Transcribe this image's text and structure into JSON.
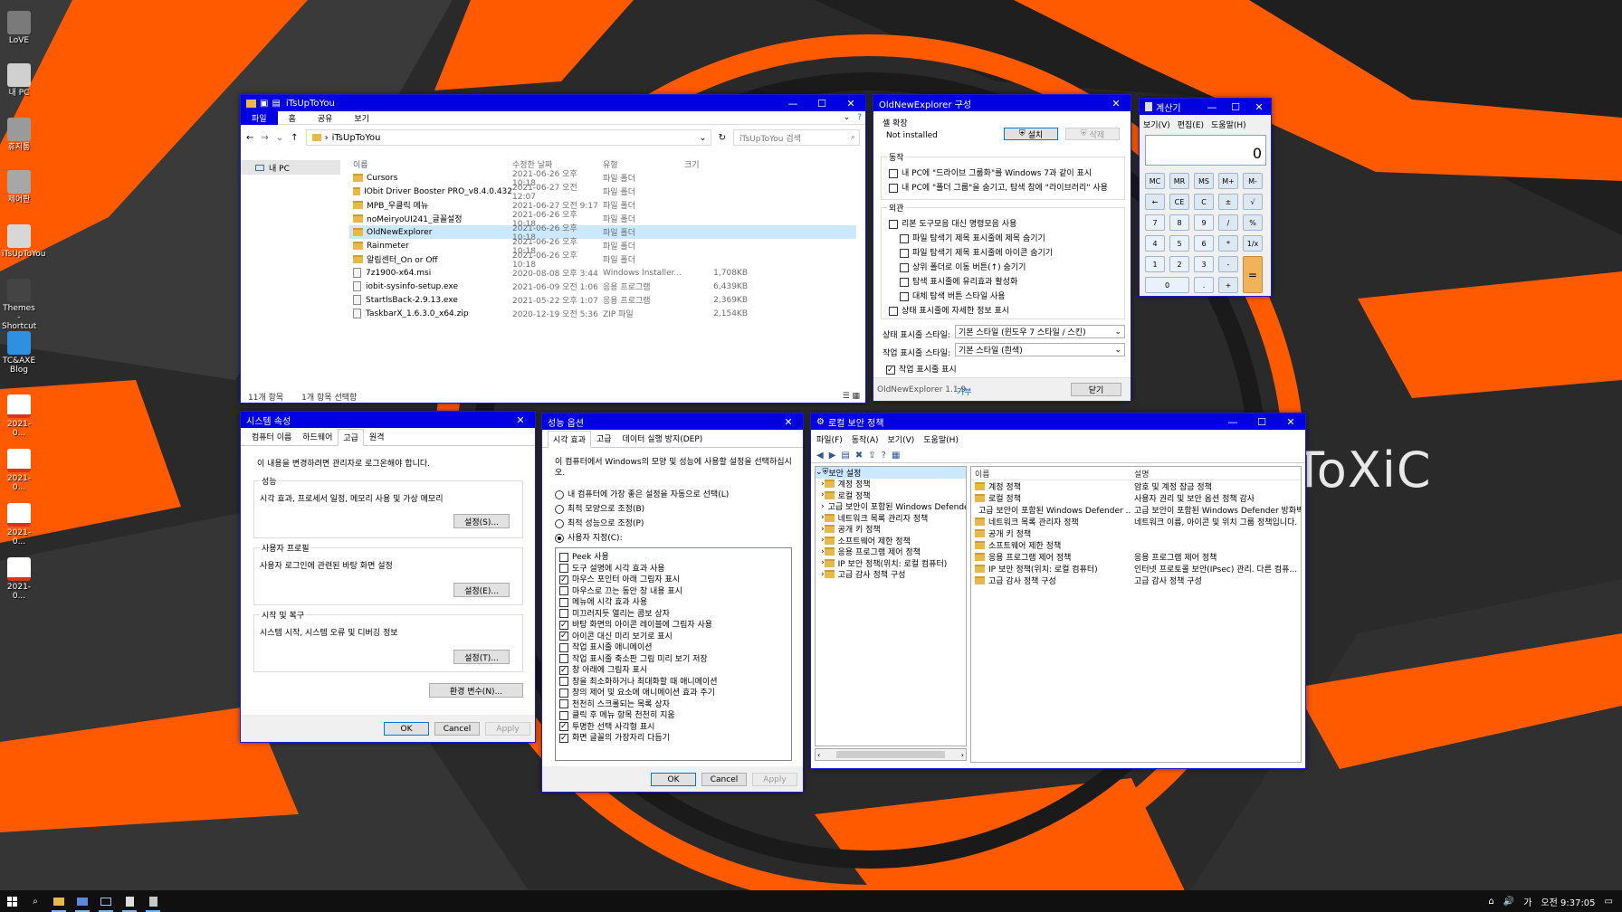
{
  "wallpaper": {
    "brand": "ToXiC",
    "colors": {
      "orange": "#ff5a00",
      "dark": "#262626",
      "mid": "#4a4a4a"
    }
  },
  "desktop_icons": [
    {
      "label": "LoVE",
      "icon": "user-icon"
    },
    {
      "label": "내 PC",
      "icon": "computer-icon"
    },
    {
      "label": "휴지통",
      "icon": "recycle-bin-icon"
    },
    {
      "label": "제어판",
      "icon": "control-panel-icon"
    },
    {
      "label": "iTsUpToYou",
      "icon": "document-icon"
    },
    {
      "label": "Themes - Shortcut",
      "icon": "shortcut-icon"
    },
    {
      "label": "TC&AXE Blog",
      "icon": "cloud-icon"
    },
    {
      "label": "2021-0...",
      "icon": "file-icon"
    },
    {
      "label": "2021-0...",
      "icon": "file-icon"
    },
    {
      "label": "2021-0...",
      "icon": "file-icon"
    },
    {
      "label": "2021-0...",
      "icon": "file-icon"
    }
  ],
  "explorer": {
    "title": "iTsUpToYou",
    "ribbon": [
      "파일",
      "홈",
      "공유",
      "보기"
    ],
    "address": "iTsUpToYou",
    "search_placeholder": "iTsUpToYou 검색",
    "nav": [
      "내 PC"
    ],
    "columns": {
      "name": "이름",
      "date": "수정한 날짜",
      "type": "유형",
      "size": "크기"
    },
    "files": [
      {
        "name": "Cursors",
        "date": "2021-06-26 오후 10:18",
        "type": "파일 폴더",
        "size": "",
        "kind": "folder"
      },
      {
        "name": "IObit Driver Booster PRO_v8.4.0.432",
        "date": "2021-06-27 오전 12:07",
        "type": "파일 폴더",
        "size": "",
        "kind": "folder"
      },
      {
        "name": "MPB_우클릭 메뉴",
        "date": "2021-06-27 오전 9:17",
        "type": "파일 폴더",
        "size": "",
        "kind": "folder"
      },
      {
        "name": "noMeiryoUI241_글꼴설정",
        "date": "2021-06-26 오후 10:18",
        "type": "파일 폴더",
        "size": "",
        "kind": "folder"
      },
      {
        "name": "OldNewExplorer",
        "date": "2021-06-26 오후 10:18",
        "type": "파일 폴더",
        "size": "",
        "kind": "folder",
        "selected": true
      },
      {
        "name": "Rainmeter",
        "date": "2021-06-26 오후 10:18",
        "type": "파일 폴더",
        "size": "",
        "kind": "folder"
      },
      {
        "name": "알림센터_On or Off",
        "date": "2021-06-26 오후 10:18",
        "type": "파일 폴더",
        "size": "",
        "kind": "folder"
      },
      {
        "name": "7z1900-x64.msi",
        "date": "2020-08-08 오후 3:44",
        "type": "Windows Installer...",
        "size": "1,708KB",
        "kind": "file"
      },
      {
        "name": "iobit-sysinfo-setup.exe",
        "date": "2021-06-09 오전 1:06",
        "type": "응용 프로그램",
        "size": "6,439KB",
        "kind": "file"
      },
      {
        "name": "StartIsBack-2.9.13.exe",
        "date": "2021-05-22 오후 1:07",
        "type": "응용 프로그램",
        "size": "2,369KB",
        "kind": "file"
      },
      {
        "name": "TaskbarX_1.6.3.0_x64.zip",
        "date": "2020-12-19 오전 5:36",
        "type": "ZIP 파일",
        "size": "2,154KB",
        "kind": "file"
      }
    ],
    "status": {
      "count": "11개 항목",
      "selected": "1개 항목 선택함"
    }
  },
  "oldnew": {
    "title": "OldNewExplorer 구성",
    "shell_group": "셸 확장",
    "shell_status": "Not installed",
    "install": "설치",
    "uninstall": "삭제",
    "behavior_group": "동작",
    "behavior": [
      {
        "label": "내 PC에 \"드라이브 그룹화\"를 Windows 7과 같이 표시",
        "checked": false
      },
      {
        "label": "내 PC에 \"폴더 그룹\"을 숨기고, 탐색 창에 \"라이브러리\" 사용",
        "checked": false
      }
    ],
    "appearance_group": "외관",
    "appearance": [
      {
        "label": "리본 도구모음 대신 명령모음 사용",
        "checked": false,
        "indent": 0
      },
      {
        "label": "파일 탐색기 제목 표시줄에 제목 숨기기",
        "checked": false,
        "indent": 1
      },
      {
        "label": "파일 탐색기 제목 표시줄에 아이콘 숨기기",
        "checked": false,
        "indent": 1
      },
      {
        "label": "상위 폴더로 이동 버튼(↑) 숨기기",
        "checked": false,
        "indent": 1
      },
      {
        "label": "탐색 표시줄에 유리효과 활성화",
        "checked": false,
        "indent": 1
      },
      {
        "label": "대체 탐색 버튼 스타일 사용",
        "checked": false,
        "indent": 1
      },
      {
        "label": "상태 표시줄에 자세한 정보 표시",
        "checked": false,
        "indent": 0
      }
    ],
    "status_style_label": "상태 표시줄 스타일:",
    "status_style_value": "기본 스타일 (윈도우 7 스타일 / 스킨)",
    "cmd_style_label": "작업 표시줄 스타일:",
    "cmd_style_value": "기본 스타일 (흰색)",
    "show_taskbar": {
      "label": "작업 표시줄 표시",
      "checked": true
    },
    "version": "OldNewExplorer 1.1.9",
    "donate": "기부",
    "close": "닫기"
  },
  "calc": {
    "title": "계산기",
    "menu": [
      "보기(V)",
      "편집(E)",
      "도움말(H)"
    ],
    "display": "0",
    "rows": [
      [
        "MC",
        "MR",
        "MS",
        "M+",
        "M-"
      ],
      [
        "←",
        "CE",
        "C",
        "±",
        "√"
      ],
      [
        "7",
        "8",
        "9",
        "/",
        "%"
      ],
      [
        "4",
        "5",
        "6",
        "*",
        "1/x"
      ],
      [
        "1",
        "2",
        "3",
        "-",
        "="
      ],
      [
        "0",
        ".",
        "+"
      ]
    ]
  },
  "sysprop": {
    "title": "시스템 속성",
    "tabs": [
      "컴퓨터 이름",
      "하드웨어",
      "고급",
      "원격"
    ],
    "note": "이 내용을 변경하려면 관리자로 로그온해야 합니다.",
    "perf_group": "성능",
    "perf_text": "시각 효과, 프로세서 일정, 메모리 사용 및 가상 메모리",
    "perf_btn": "설정(S)...",
    "profile_group": "사용자 프로필",
    "profile_text": "사용자 로그인에 관련된 바탕 화면 설정",
    "profile_btn": "설정(E)...",
    "startup_group": "시작 및 복구",
    "startup_text": "시스템 시작, 시스템 오류 및 디버깅 정보",
    "startup_btn": "설정(T)...",
    "env_btn": "환경 변수(N)...",
    "ok": "OK",
    "cancel": "Cancel",
    "apply": "Apply"
  },
  "perf": {
    "title": "성능 옵션",
    "tabs": [
      "시각 효과",
      "고급",
      "데이터 실행 방지(DEP)"
    ],
    "intro": "이 컴퓨터에서 Windows의 모양 및 성능에 사용할 설정을 선택하십시오.",
    "radios": [
      {
        "label": "내 컴퓨터에 가장 좋은 설정을 자동으로 선택(L)",
        "on": false
      },
      {
        "label": "최적 모양으로 조정(B)",
        "on": false
      },
      {
        "label": "최적 성능으로 조정(P)",
        "on": false
      },
      {
        "label": "사용자 지정(C):",
        "on": true
      }
    ],
    "options": [
      {
        "label": "Peek 사용",
        "checked": false
      },
      {
        "label": "도구 설명에 시각 효과 사용",
        "checked": false
      },
      {
        "label": "마우스 포인터 아래 그림자 표시",
        "checked": true
      },
      {
        "label": "마우스로 끄는 동안 창 내용 표시",
        "checked": false
      },
      {
        "label": "메뉴에 시각 효과 사용",
        "checked": false
      },
      {
        "label": "미끄러지듯 열리는 콤보 상자",
        "checked": false
      },
      {
        "label": "바탕 화면의 아이콘 레이블에 그림자 사용",
        "checked": true
      },
      {
        "label": "아이콘 대신 미리 보기로 표시",
        "checked": true
      },
      {
        "label": "작업 표시줄 애니메이션",
        "checked": false
      },
      {
        "label": "작업 표시줄 축소판 그림 미리 보기 저장",
        "checked": false
      },
      {
        "label": "창 아래에 그림자 표시",
        "checked": true
      },
      {
        "label": "창을 최소화하거나 최대화할 때 애니메이션",
        "checked": false
      },
      {
        "label": "창의 제어 및 요소에 애니메이션 효과 주기",
        "checked": false
      },
      {
        "label": "천천히 스크롤되는 목록 상자",
        "checked": false
      },
      {
        "label": "클릭 후 메뉴 항목 천천히 지움",
        "checked": false
      },
      {
        "label": "투명한 선택 사각형 표시",
        "checked": true
      },
      {
        "label": "화면 글꼴의 가장자리 다듬기",
        "checked": true
      }
    ],
    "ok": "OK",
    "cancel": "Cancel",
    "apply": "Apply"
  },
  "lsp": {
    "title": "로컬 보안 정책",
    "menu": [
      "파일(F)",
      "동작(A)",
      "보기(V)",
      "도움말(H)"
    ],
    "tree_root": "보안 설정",
    "tree": [
      "계정 정책",
      "로컬 정책",
      "고급 보안이 포함된 Windows Defender",
      "네트워크 목록 관리자 정책",
      "공개 키 정책",
      "소프트웨어 제한 정책",
      "응용 프로그램 제어 정책",
      "IP 보안 정책(위치: 로컬 컴퓨터)",
      "고급 감사 정책 구성"
    ],
    "col_name": "이름",
    "col_desc": "설명",
    "rows": [
      {
        "name": "계정 정책",
        "desc": "암호 및 계정 잠금 정책"
      },
      {
        "name": "로컬 정책",
        "desc": "사용자 권리 및 보안 옵션 정책 감사"
      },
      {
        "name": "고급 보안이 포함된 Windows Defender ...",
        "desc": "고급 보안이 포함된 Windows Defender 방화벽"
      },
      {
        "name": "네트워크 목록 관리자 정책",
        "desc": "네트워크 이름, 아이콘 및 위치 그룹 정책입니다."
      },
      {
        "name": "공개 키 정책",
        "desc": ""
      },
      {
        "name": "소프트웨어 제한 정책",
        "desc": ""
      },
      {
        "name": "응용 프로그램 제어 정책",
        "desc": "응용 프로그램 제어 정책"
      },
      {
        "name": "IP 보안 정책(위치: 로컬 컴퓨터)",
        "desc": "인터넷 프로토콜 보안(IPsec) 관리. 다른 컴퓨..."
      },
      {
        "name": "고급 감사 정책 구성",
        "desc": "고급 감사 정책 구성"
      }
    ]
  },
  "taskbar": {
    "ime": "가",
    "clock": "오전 9:37:05"
  }
}
